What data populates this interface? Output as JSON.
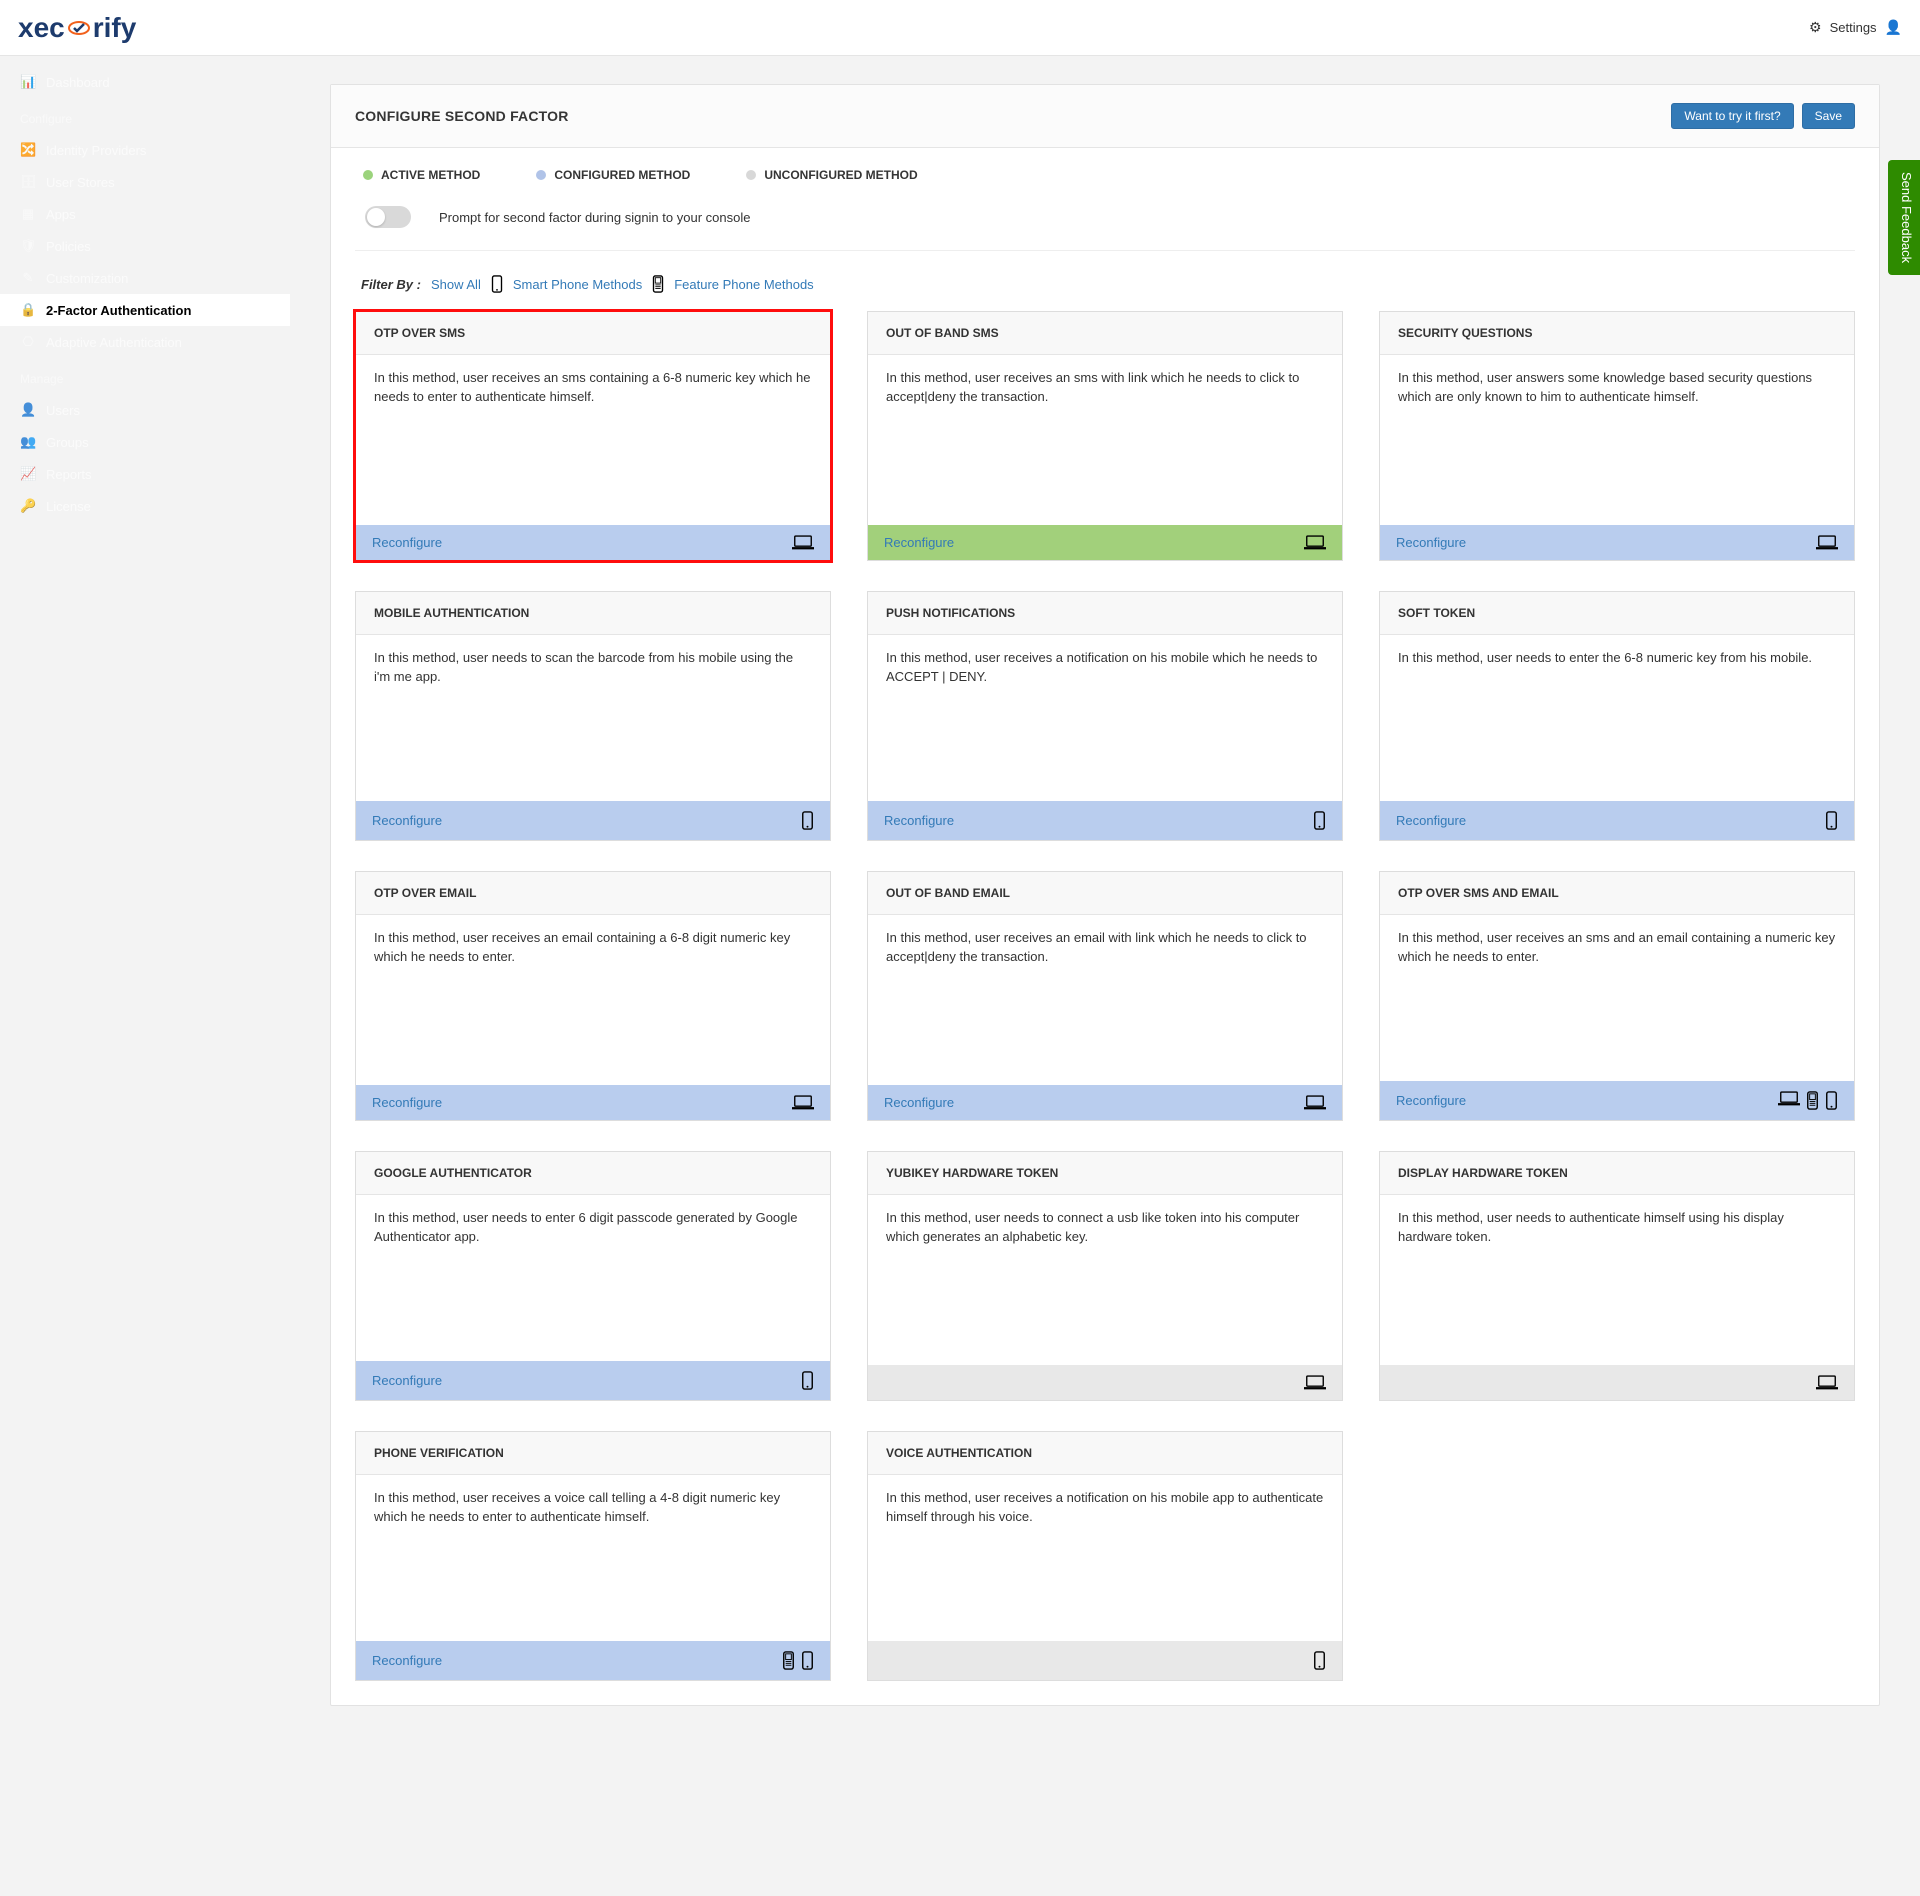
{
  "brand": {
    "name_pre": "xec",
    "name_post": "rify"
  },
  "header": {
    "settings": "Settings"
  },
  "sidebar": {
    "items": [
      {
        "label": "Dashboard"
      },
      {
        "section": "Configure"
      },
      {
        "label": "Identity Providers"
      },
      {
        "label": "User Stores"
      },
      {
        "label": "Apps"
      },
      {
        "label": "Policies"
      },
      {
        "label": "Customization"
      },
      {
        "label": "2-Factor Authentication",
        "active": true
      },
      {
        "label": "Adaptive Authentication"
      },
      {
        "section": "Manage"
      },
      {
        "label": "Users"
      },
      {
        "label": "Groups"
      },
      {
        "label": "Reports"
      },
      {
        "label": "License"
      }
    ]
  },
  "panel": {
    "title": "CONFIGURE SECOND FACTOR",
    "try_btn": "Want to try it first?",
    "save_btn": "Save",
    "legend": {
      "active": "ACTIVE METHOD",
      "configured": "CONFIGURED METHOD",
      "unconfigured": "UNCONFIGURED METHOD"
    },
    "prompt_text": "Prompt for second factor during signin to your console",
    "filter": {
      "label": "Filter By :",
      "show_all": "Show All",
      "smart": "Smart Phone Methods",
      "feature": "Feature Phone Methods"
    },
    "cards": [
      {
        "title": "OTP OVER SMS",
        "desc": "In this method, user receives an sms containing a 6-8 numeric key which he needs to enter to authenticate himself.",
        "foot": "blue",
        "reconfig": "Reconfigure",
        "icons": [
          "laptop"
        ],
        "highlight": true
      },
      {
        "title": "OUT OF BAND SMS",
        "desc": "In this method, user receives an sms with link which he needs to click to accept|deny the transaction.",
        "foot": "green",
        "reconfig": "Reconfigure",
        "icons": [
          "laptop"
        ]
      },
      {
        "title": "SECURITY QUESTIONS",
        "desc": "In this method, user answers some knowledge based security questions which are only known to him to authenticate himself.",
        "foot": "blue",
        "reconfig": "Reconfigure",
        "icons": [
          "laptop"
        ]
      },
      {
        "title": "MOBILE AUTHENTICATION",
        "desc": "In this method, user needs to scan the barcode from his mobile using the i'm me app.",
        "foot": "blue",
        "reconfig": "Reconfigure",
        "icons": [
          "smart"
        ]
      },
      {
        "title": "PUSH NOTIFICATIONS",
        "desc": "In this method, user receives a notification on his mobile which he needs to ACCEPT | DENY.",
        "foot": "blue",
        "reconfig": "Reconfigure",
        "icons": [
          "smart"
        ]
      },
      {
        "title": "SOFT TOKEN",
        "desc": "In this method, user needs to enter the 6-8 numeric key from his mobile.",
        "foot": "blue",
        "reconfig": "Reconfigure",
        "icons": [
          "smart"
        ]
      },
      {
        "title": "OTP OVER EMAIL",
        "desc": "In this method, user receives an email containing a 6-8 digit numeric key which he needs to enter.",
        "foot": "blue",
        "reconfig": "Reconfigure",
        "icons": [
          "laptop"
        ]
      },
      {
        "title": "OUT OF BAND EMAIL",
        "desc": "In this method, user receives an email with link which he needs to click to accept|deny the transaction.",
        "foot": "blue",
        "reconfig": "Reconfigure",
        "icons": [
          "laptop"
        ]
      },
      {
        "title": "OTP OVER SMS AND EMAIL",
        "desc": "In this method, user receives an sms and an email containing a numeric key which he needs to enter.",
        "foot": "blue",
        "reconfig": "Reconfigure",
        "icons": [
          "laptop",
          "feature",
          "smart"
        ]
      },
      {
        "title": "GOOGLE AUTHENTICATOR",
        "desc": "In this method, user needs to enter 6 digit passcode generated by Google Authenticator app.",
        "foot": "blue",
        "reconfig": "Reconfigure",
        "icons": [
          "smart"
        ]
      },
      {
        "title": "YUBIKEY HARDWARE TOKEN",
        "desc": "In this method, user needs to connect a usb like token into his computer which generates an alphabetic key.",
        "foot": "grey",
        "reconfig": "",
        "icons": [
          "laptop"
        ]
      },
      {
        "title": "DISPLAY HARDWARE TOKEN",
        "desc": "In this method, user needs to authenticate himself using his display hardware token.",
        "foot": "grey",
        "reconfig": "",
        "icons": [
          "laptop"
        ]
      },
      {
        "title": "PHONE VERIFICATION",
        "desc": "In this method, user receives a voice call telling a 4-8 digit numeric key which he needs to enter to authenticate himself.",
        "foot": "blue",
        "reconfig": "Reconfigure",
        "icons": [
          "feature",
          "smart"
        ]
      },
      {
        "title": "VOICE AUTHENTICATION",
        "desc": "In this method, user receives a notification on his mobile app to authenticate himself through his voice.",
        "foot": "grey",
        "reconfig": "",
        "icons": [
          "smart"
        ]
      }
    ]
  },
  "feedback": "Send Feedback"
}
